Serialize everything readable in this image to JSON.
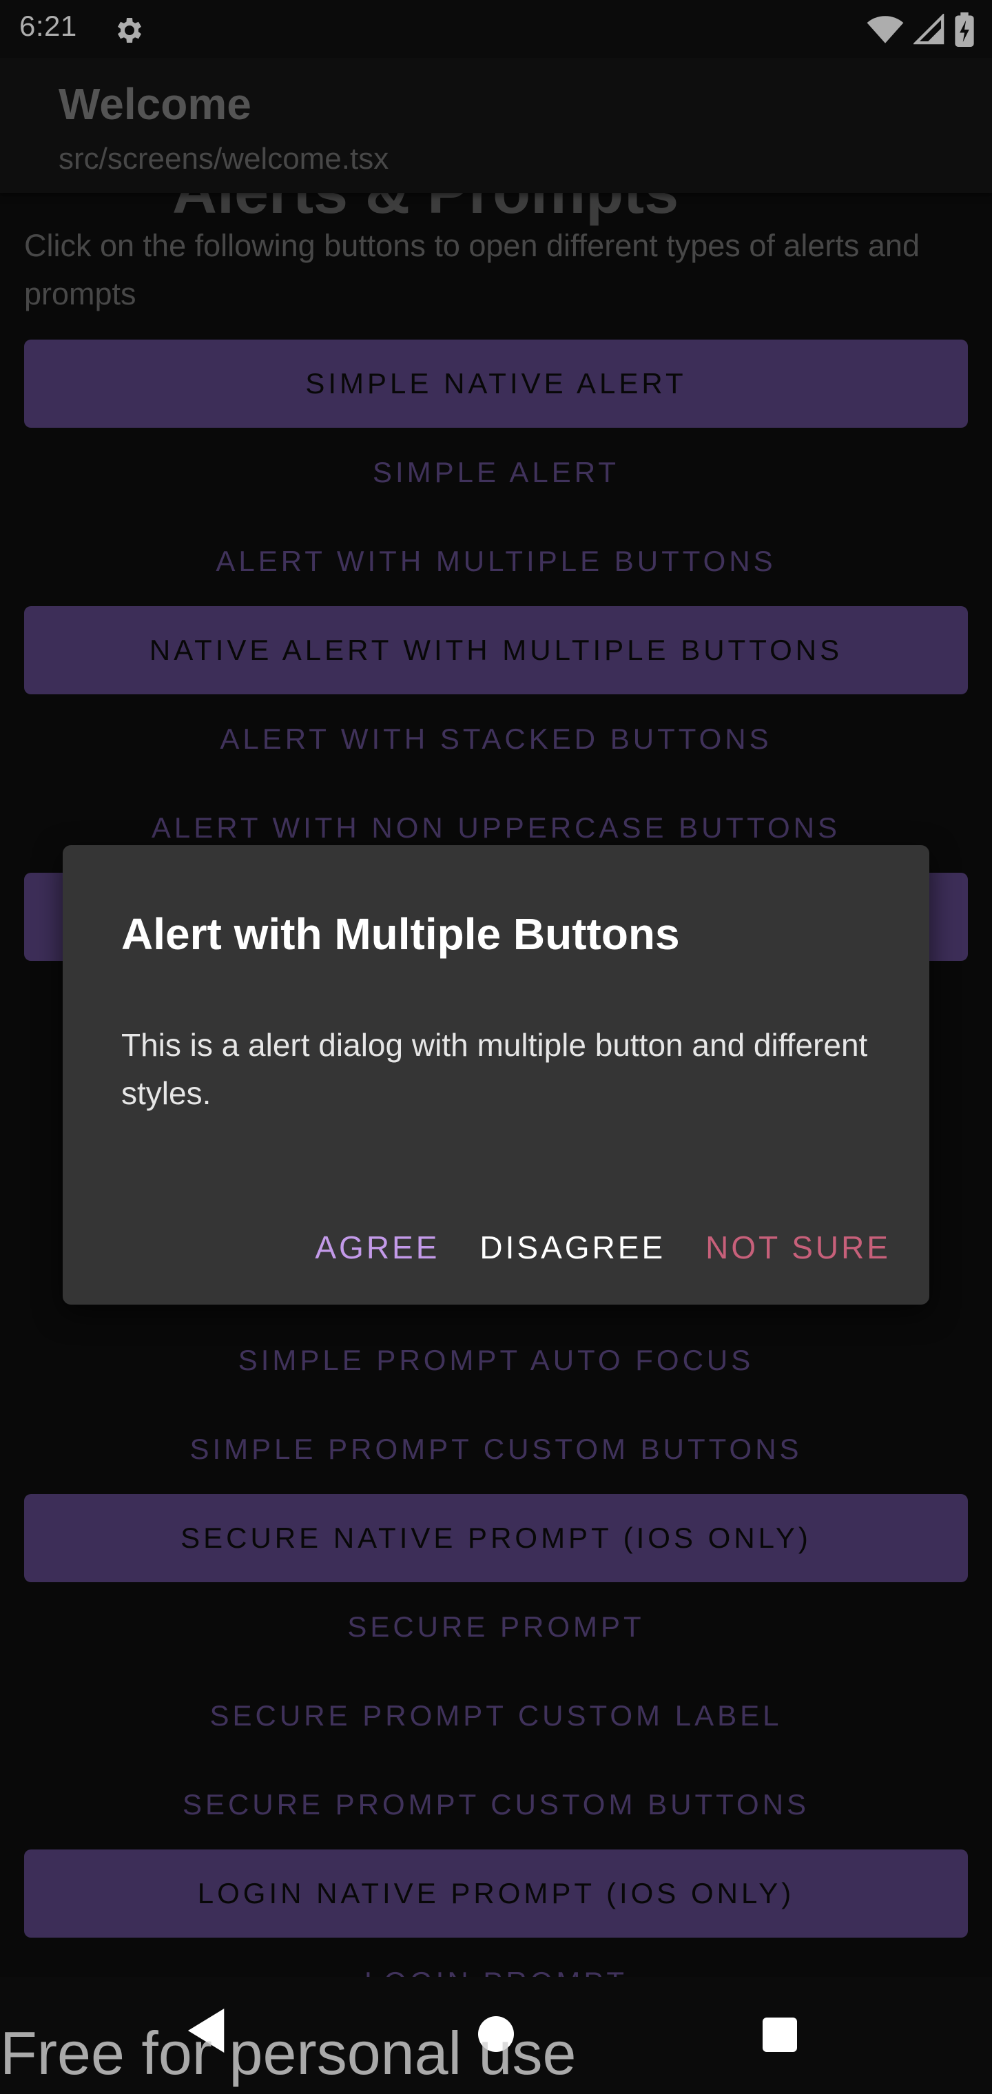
{
  "status_bar": {
    "time": "6:21"
  },
  "app_bar": {
    "title": "Welcome",
    "subtitle": "src/screens/welcome.tsx"
  },
  "content": {
    "heading_partial": "Alerts & Prompts",
    "intro": "Click on the following buttons to open different types of alerts and prompts",
    "buttons": [
      {
        "label": "SIMPLE NATIVE ALERT",
        "style": "filled"
      },
      {
        "label": "SIMPLE ALERT",
        "style": "text"
      },
      {
        "label": "ALERT WITH MULTIPLE BUTTONS",
        "style": "text"
      },
      {
        "label": "NATIVE ALERT WITH MULTIPLE BUTTONS",
        "style": "filled"
      },
      {
        "label": "ALERT WITH STACKED BUTTONS",
        "style": "text"
      },
      {
        "label": "ALERT WITH NON UPPERCASE BUTTONS",
        "style": "text"
      },
      {
        "label": "",
        "style": "filled"
      },
      {
        "label": "SIMPLE PROMPT AUTO FOCUS",
        "style": "text"
      },
      {
        "label": "SIMPLE PROMPT CUSTOM BUTTONS",
        "style": "text"
      },
      {
        "label": "SECURE NATIVE PROMPT (IOS ONLY)",
        "style": "filled"
      },
      {
        "label": "SECURE PROMPT",
        "style": "text"
      },
      {
        "label": "SECURE PROMPT CUSTOM LABEL",
        "style": "text"
      },
      {
        "label": "SECURE PROMPT CUSTOM BUTTONS",
        "style": "text"
      },
      {
        "label": "LOGIN NATIVE PROMPT (IOS ONLY)",
        "style": "filled"
      },
      {
        "label": "LOGIN PROMPT",
        "style": "text"
      }
    ]
  },
  "dialog": {
    "title": "Alert with Multiple Buttons",
    "message": "This is a alert dialog with multiple button and different styles.",
    "actions": {
      "agree": "AGREE",
      "disagree": "DISAGREE",
      "not_sure": "NOT SURE"
    }
  },
  "watermark": "Free for personal use",
  "colors": {
    "primary": "#5b4582",
    "text_button": "#5f4b86",
    "agree": "#c39ae9",
    "not_sure": "#c7607a",
    "dialog_bg": "#353535"
  }
}
